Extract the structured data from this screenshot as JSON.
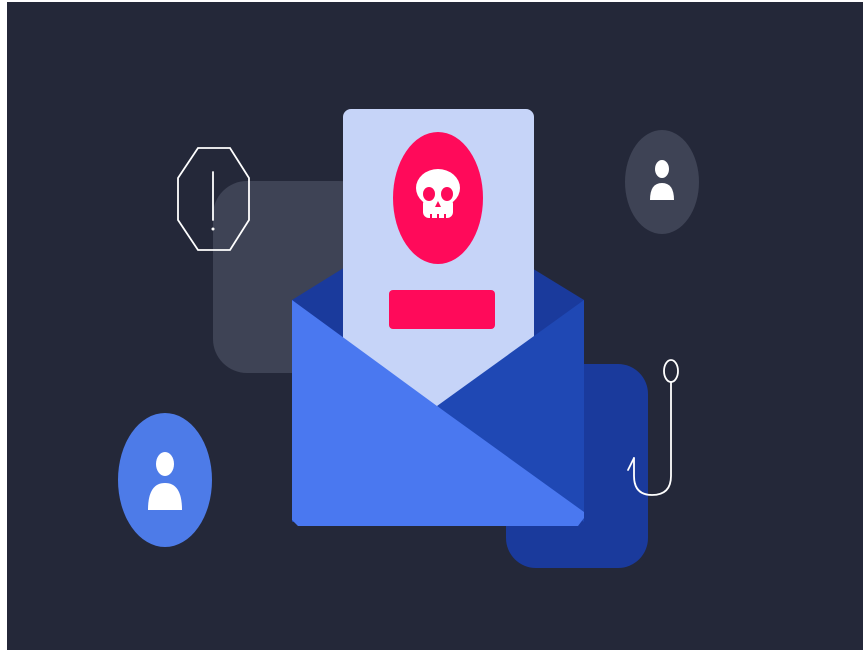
{
  "illustration": {
    "background_color": "#242839",
    "envelope": {
      "flap_color": "#1a3a9c",
      "back_color": "#1a3a9c",
      "left_panel_color": "#4a78f0",
      "right_panel_color": "#1f48b4"
    },
    "letter": {
      "paper_color": "#c6d4f8",
      "skull_badge_color": "#ff0a5a",
      "bar_color": "#ff0a5a"
    },
    "icons": {
      "warning": "octagon-exclamation-icon",
      "user_light": "user-icon",
      "user_blue": "user-icon",
      "hook": "fishing-hook-icon"
    },
    "tile_colors": {
      "grey": "#3e4355",
      "navy": "#1a3a9c",
      "user_grey": "#3e4355",
      "user_blue": "#4d7be8"
    }
  }
}
